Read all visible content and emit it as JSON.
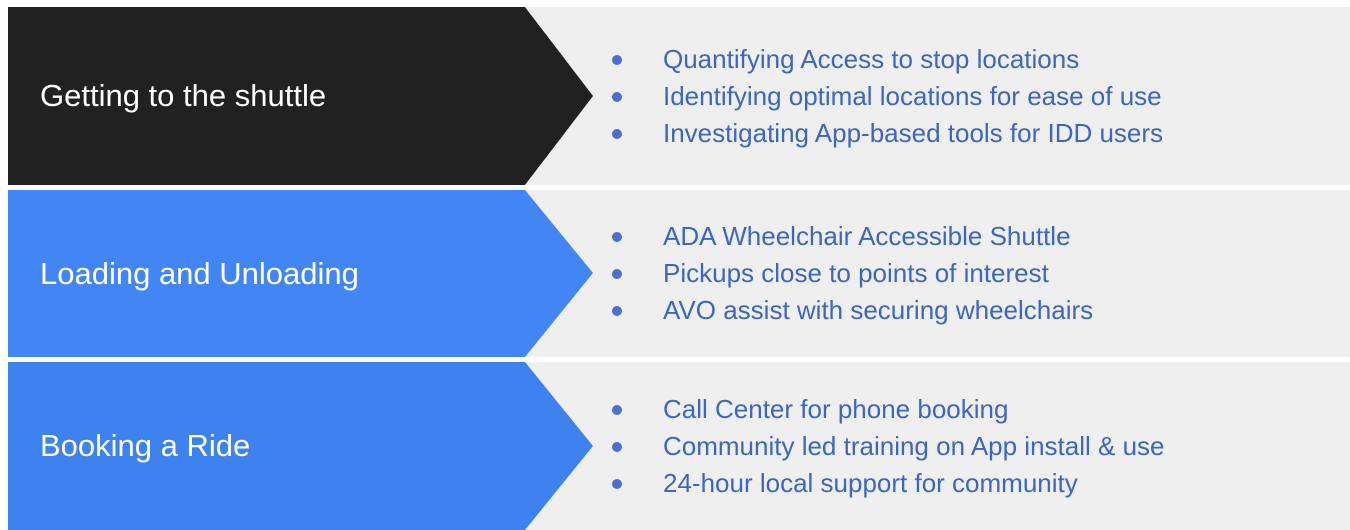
{
  "rows": [
    {
      "title": "Getting to the shuttle",
      "color": "#212121",
      "bullets": [
        "Quantifying Access to stop locations",
        "Identifying optimal locations for ease of use",
        "Investigating App-based tools for IDD users"
      ]
    },
    {
      "title": "Loading and Unloading",
      "color": "#4285f4",
      "bullets": [
        "ADA Wheelchair Accessible Shuttle",
        "Pickups close to points of interest",
        "AVO assist with securing wheelchairs"
      ]
    },
    {
      "title": "Booking a Ride",
      "color": "#3d82ef",
      "bullets": [
        "Call Center for phone booking",
        "Community led training on App install & use",
        "24-hour local support for community"
      ]
    }
  ],
  "colors": {
    "panel_bg": "#efefef",
    "bullet_text": "#3c66c3",
    "title_text": "#ffffff"
  }
}
